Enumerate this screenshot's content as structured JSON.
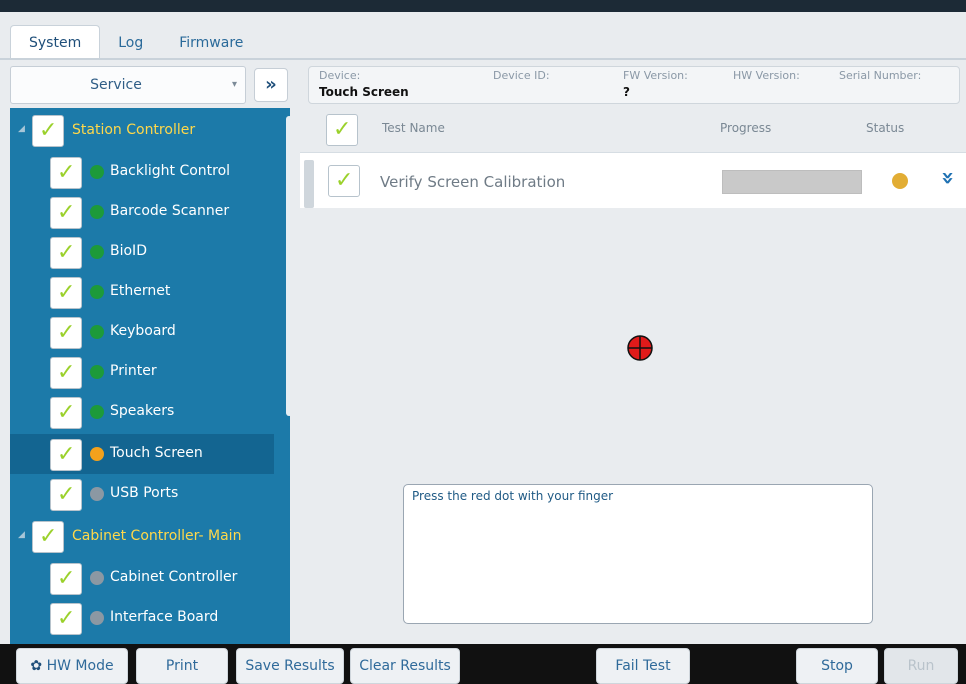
{
  "tabs": [
    {
      "label": "System",
      "active": true
    },
    {
      "label": "Log",
      "active": false
    },
    {
      "label": "Firmware",
      "active": false
    }
  ],
  "service_select": {
    "value": "Service"
  },
  "info": {
    "device_label": "Device:",
    "device_value": "Touch Screen",
    "device_id_label": "Device ID:",
    "fw_label": "FW Version:",
    "fw_value": "?",
    "hw_label": "HW Version:",
    "serial_label": "Serial Number:"
  },
  "tree": {
    "groups": [
      {
        "label": "Station Controller",
        "items": [
          {
            "label": "Backlight Control",
            "status": "green"
          },
          {
            "label": "Barcode Scanner",
            "status": "green"
          },
          {
            "label": "BioID",
            "status": "green"
          },
          {
            "label": "Ethernet",
            "status": "green"
          },
          {
            "label": "Keyboard",
            "status": "green"
          },
          {
            "label": "Printer",
            "status": "green"
          },
          {
            "label": "Speakers",
            "status": "green"
          },
          {
            "label": "Touch Screen",
            "status": "orange",
            "selected": true
          },
          {
            "label": "USB Ports",
            "status": "gray"
          }
        ]
      },
      {
        "label": "Cabinet Controller- Main",
        "items": [
          {
            "label": "Cabinet Controller",
            "status": "gray"
          },
          {
            "label": "Interface Board",
            "status": "gray"
          }
        ]
      }
    ]
  },
  "table": {
    "headers": {
      "name": "Test Name",
      "progress": "Progress",
      "status": "Status"
    },
    "rows": [
      {
        "name": "Verify Screen Calibration",
        "progress": 1.0,
        "status": "pending"
      }
    ]
  },
  "message": "Press the red dot with your finger",
  "buttons": {
    "hw_mode": "HW Mode",
    "print": "Print",
    "save": "Save Results",
    "clear": "Clear Results",
    "fail": "Fail Test",
    "stop": "Stop",
    "run": "Run"
  },
  "colors": {
    "green": "#1d9a3a",
    "orange": "#f3a11c",
    "gray": "#8b98a3",
    "accent": "#1c7aa9"
  }
}
